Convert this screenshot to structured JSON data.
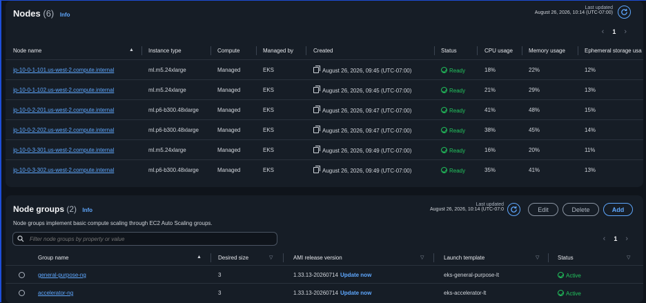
{
  "nodes": {
    "title": "Nodes",
    "count": "(6)",
    "info": "Info",
    "last_updated_label": "Last updated",
    "last_updated_value": "August 26, 2026, 10:14 (UTC-07:00)",
    "page": "1",
    "columns": [
      "Node name",
      "Instance type",
      "Compute",
      "Managed by",
      "Created",
      "Status",
      "CPU usage",
      "Memory usage",
      "Ephemeral storage usa"
    ],
    "rows": [
      {
        "name": "ip-10-0-1-101.us-west-2.compute.internal",
        "instance": "ml.m5.24xlarge",
        "compute": "Managed",
        "managed_by": "EKS",
        "created": "August 26, 2026, 09:45 (UTC-07:00)",
        "status": "Ready",
        "cpu": "18%",
        "memory": "22%",
        "storage": "12%"
      },
      {
        "name": "ip-10-0-1-102.us-west-2.compute.internal",
        "instance": "ml.m5.24xlarge",
        "compute": "Managed",
        "managed_by": "EKS",
        "created": "August 26, 2026, 09:45 (UTC-07:00)",
        "status": "Ready",
        "cpu": "21%",
        "memory": "29%",
        "storage": "13%"
      },
      {
        "name": "ip-10-0-2-201.us-west-2.compute.internal",
        "instance": "ml.p6-b300.48xlarge",
        "compute": "Managed",
        "managed_by": "EKS",
        "created": "August 26, 2026, 09:47 (UTC-07:00)",
        "status": "Ready",
        "cpu": "41%",
        "memory": "48%",
        "storage": "15%"
      },
      {
        "name": "ip-10-0-2-202.us-west-2.compute.internal",
        "instance": "ml.p6-b300.48xlarge",
        "compute": "Managed",
        "managed_by": "EKS",
        "created": "August 26, 2026, 09:47 (UTC-07:00)",
        "status": "Ready",
        "cpu": "38%",
        "memory": "45%",
        "storage": "14%"
      },
      {
        "name": "ip-10-0-3-301.us-west-2.compute.internal",
        "instance": "ml.m5.24xlarge",
        "compute": "Managed",
        "managed_by": "EKS",
        "created": "August 26, 2026, 09:49 (UTC-07:00)",
        "status": "Ready",
        "cpu": "16%",
        "memory": "20%",
        "storage": "11%"
      },
      {
        "name": "ip-10-0-3-302.us-west-2.compute.internal",
        "instance": "ml.p6-b300.48xlarge",
        "compute": "Managed",
        "managed_by": "EKS",
        "created": "August 26, 2026, 09:49 (UTC-07:00)",
        "status": "Ready",
        "cpu": "35%",
        "memory": "41%",
        "storage": "13%"
      }
    ]
  },
  "node_groups": {
    "title": "Node groups",
    "count": "(2)",
    "info": "Info",
    "description": "Node groups implement basic compute scaling through EC2 Auto Scaling groups.",
    "last_updated_label": "Last updated",
    "last_updated_value": "August 26, 2026, 10:14 (UTC-07:0",
    "edit": "Edit",
    "delete": "Delete",
    "add": "Add",
    "filter_placeholder": "Filter node groups by property or value",
    "page": "1",
    "columns": [
      "Group name",
      "Desired size",
      "AMI release version",
      "Launch template",
      "Status"
    ],
    "rows": [
      {
        "name": "general-purpose-ng",
        "desired": "3",
        "ami": "1.33.13-20260714",
        "update": "Update now",
        "template": "eks-general-purpose-lt",
        "status": "Active"
      },
      {
        "name": "accelerator-ng",
        "desired": "3",
        "ami": "1.33.13-20260714",
        "update": "Update now",
        "template": "eks-accelerator-lt",
        "status": "Active"
      }
    ]
  },
  "colors": {
    "accent": "#5fa8ff",
    "ok": "#22c55e",
    "bg": "#0f141b",
    "panel": "#161d26"
  },
  "icons": [
    "refresh-icon",
    "copy-icon",
    "status-ok-icon",
    "search-icon",
    "sort-icon",
    "chevron-left-icon",
    "chevron-right-icon"
  ]
}
